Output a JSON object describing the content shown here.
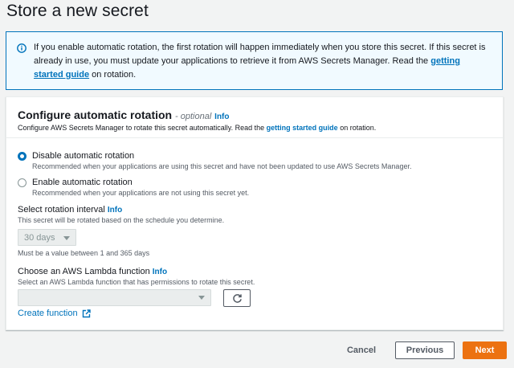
{
  "page": {
    "title": "Store a new secret"
  },
  "alert": {
    "text": "If you enable automatic rotation, the first rotation will happen immediately when you store this secret. If this secret is already in use, you must update your applications to retrieve it from AWS Secrets Manager. Read the",
    "link": "getting started guide",
    "suffix": "on rotation."
  },
  "panel": {
    "title": "Configure automatic rotation",
    "optional": "- optional",
    "info": "Info",
    "desc_prefix": "Configure AWS Secrets Manager to rotate this secret automatically. Read the",
    "desc_link": "getting started guide",
    "desc_suffix": "on rotation."
  },
  "rotation_options": [
    {
      "label": "Disable automatic rotation",
      "desc": "Recommended when your applications are using this secret and have not been updated to use AWS Secrets Manager.",
      "checked": true
    },
    {
      "label": "Enable automatic rotation",
      "desc": "Recommended when your applications are not using this secret yet.",
      "checked": false
    }
  ],
  "interval": {
    "label": "Select rotation interval",
    "info": "Info",
    "desc": "This secret will be rotated based on the schedule you determine.",
    "value": "30 days",
    "constraint": "Must be a value between 1 and 365 days"
  },
  "lambda": {
    "label": "Choose an AWS Lambda function",
    "info": "Info",
    "desc": "Select an AWS Lambda function that has permissions to rotate this secret.",
    "value": "",
    "create_link": "Create function"
  },
  "footer": {
    "cancel": "Cancel",
    "previous": "Previous",
    "next": "Next"
  },
  "colors": {
    "accent": "#0073bb",
    "primary_button": "#ec7211",
    "alert_bg": "#f1faff"
  }
}
